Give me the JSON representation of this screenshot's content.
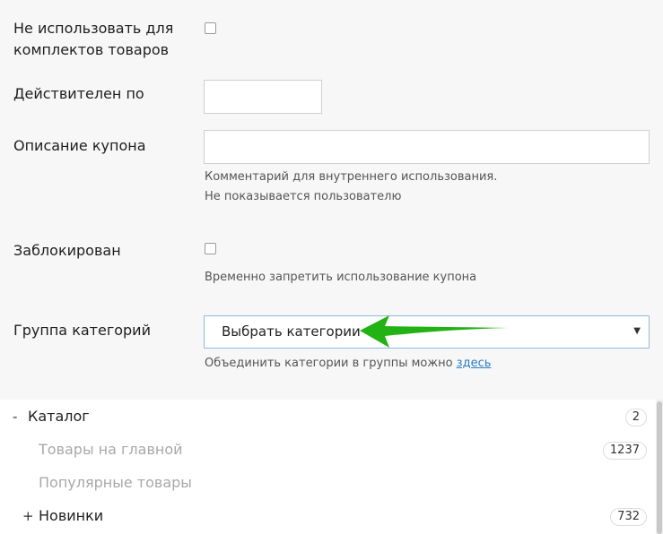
{
  "form": {
    "no_bundles_label_line1": "Не использовать для",
    "no_bundles_label_line2": "комплектов товаров",
    "valid_until_label": "Действителен по",
    "valid_until_value": "",
    "description_label": "Описание купона",
    "description_value": "",
    "description_hint_line1": "Комментарий для внутреннего использования.",
    "description_hint_line2": "Не показывается пользователю",
    "blocked_label": "Заблокирован",
    "blocked_hint": "Временно запретить использование купона",
    "category_group_label": "Группа категорий",
    "category_group_select": "Выбрать категории",
    "category_group_hint_prefix": "Объединить категории в группы можно",
    "category_group_hint_link": "здесь"
  },
  "tree": {
    "items": [
      {
        "toggle": "-",
        "label": "Каталог",
        "count": "2"
      },
      {
        "toggle": "",
        "label": "Товары на главной",
        "count": "1237"
      },
      {
        "toggle": "",
        "label": "Популярные товары",
        "count": ""
      },
      {
        "toggle": "+",
        "label": "Новинки",
        "count": "732"
      }
    ]
  },
  "colors": {
    "annotation_arrow": "#22b214",
    "link": "#2a7fc4"
  }
}
